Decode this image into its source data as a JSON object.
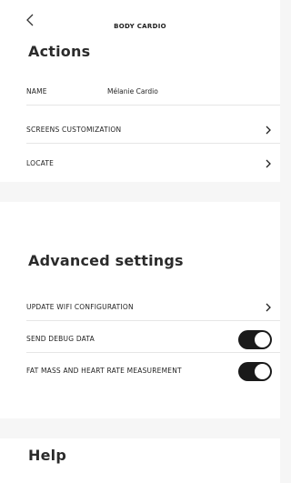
{
  "header": {
    "title": "BODY CARDIO",
    "back_icon": "chevron-left-icon"
  },
  "actions": {
    "title": "Actions",
    "name_label": "NAME",
    "name_value": "Mélanie Cardio",
    "screens_label": "SCREENS CUSTOMIZATION",
    "locate_label": "LOCATE"
  },
  "advanced": {
    "title": "Advanced settings",
    "wifi_label": "UPDATE WIFI CONFIGURATION",
    "debug_label": "SEND DEBUG DATA",
    "debug_enabled": true,
    "fat_label": "FAT MASS AND HEART RATE MEASUREMENT",
    "fat_enabled": true
  },
  "help": {
    "title": "Help"
  },
  "colors": {
    "toggle_on": "#1a1a1a",
    "background": "#f6f6f6",
    "card": "#ffffff"
  }
}
